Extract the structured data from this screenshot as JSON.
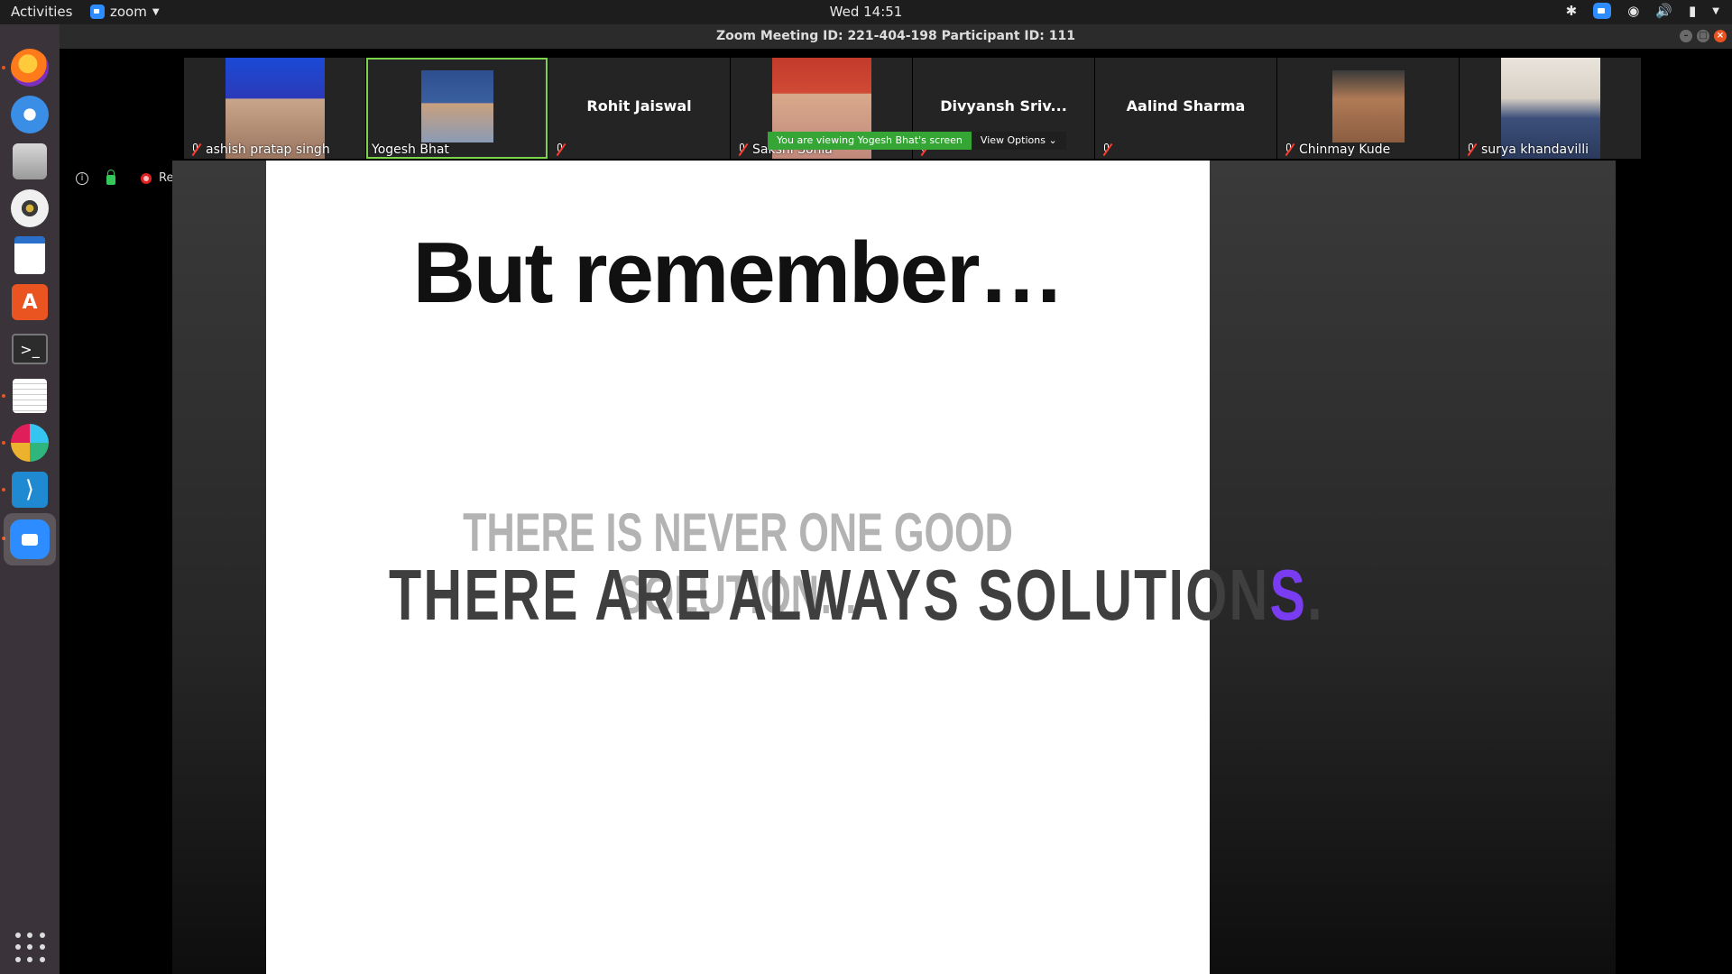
{
  "topbar": {
    "activities": "Activities",
    "app_name": "zoom",
    "clock": "Wed 14:51"
  },
  "window": {
    "title": "Zoom Meeting ID: 221-404-198 Participant ID: 111"
  },
  "participants": [
    {
      "name": "ashish pratap singh",
      "video": true
    },
    {
      "name": "Yogesh Bhat",
      "video": true,
      "active": true
    },
    {
      "name": "Rohit Jaiswal",
      "video": false
    },
    {
      "name": "Sakshi Sonia",
      "video": true
    },
    {
      "name": "Divyansh Sriv...",
      "video": false
    },
    {
      "name": "Aalind Sharma",
      "video": false
    },
    {
      "name": "Chinmay Kude",
      "video": true
    },
    {
      "name": "surya khandavilli",
      "video": true
    }
  ],
  "meeting": {
    "recording_label": "Recording",
    "viewing_notice": "You are viewing Yogesh Bhat's screen",
    "view_options": "View Options"
  },
  "slide": {
    "title": "But remember…",
    "line1": "THERE IS NEVER ONE GOOD SOLUTION…",
    "line2_main": "THERE ARE ALWAYS SOLUTION",
    "line2_accent": "S",
    "line2_end": "."
  },
  "colors": {
    "accent_purple": "#7a3cf0",
    "zoom_blue": "#2d8cff",
    "active_speaker_green": "#7bd54b",
    "viewing_green": "#35a535"
  },
  "dock": [
    "firefox",
    "thunderbird",
    "files",
    "rhythmbox",
    "libreoffice-writer",
    "software-center",
    "terminal",
    "text-editor",
    "slack",
    "vscode",
    "zoom"
  ]
}
